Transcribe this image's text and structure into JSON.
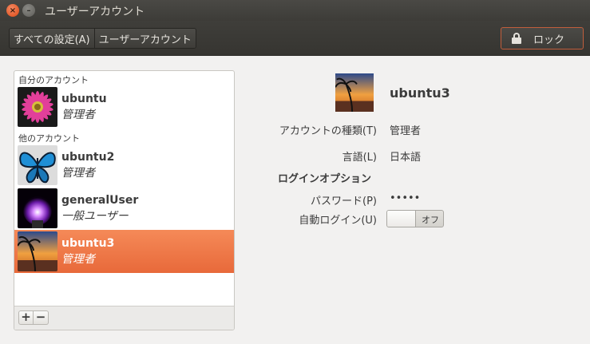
{
  "window": {
    "title": "ユーザーアカウント",
    "close_glyph": "×",
    "minimize_glyph": "–"
  },
  "toolbar": {
    "breadcrumbs": [
      "すべての設定(A)",
      "ユーザーアカウント"
    ],
    "lock_label": "ロック",
    "lock_accent": "#c15e3c"
  },
  "user_list": {
    "my_account_label": "自分のアカウント",
    "other_accounts_label": "他のアカウント",
    "users": [
      {
        "name": "ubuntu",
        "role": "管理者",
        "avatar": "pink-flower-icon"
      },
      {
        "name": "ubuntu2",
        "role": "管理者",
        "avatar": "blue-butterfly-icon"
      },
      {
        "name": "generalUser",
        "role": "一般ユーザー",
        "avatar": "plasma-lamp-icon"
      },
      {
        "name": "ubuntu3",
        "role": "管理者",
        "avatar": "sunset-palm-icon",
        "selected": true
      }
    ],
    "add_glyph": "+",
    "remove_glyph": "−",
    "selection_color": "#f07746"
  },
  "details": {
    "name": "ubuntu3",
    "account_type_label": "アカウントの種類(T)",
    "account_type_value": "管理者",
    "language_label": "言語(L)",
    "language_value": "日本語",
    "login_options_header": "ログインオプション",
    "password_label": "パスワード(P)",
    "password_value": "•••••",
    "autologin_label": "自動ログイン(U)",
    "autologin_value": "オフ"
  }
}
